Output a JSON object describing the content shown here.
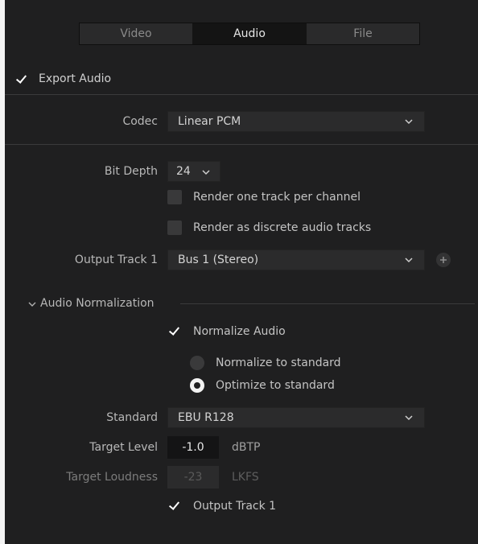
{
  "tabs": [
    {
      "label": "Video",
      "active": false
    },
    {
      "label": "Audio",
      "active": true
    },
    {
      "label": "File",
      "active": false
    }
  ],
  "export_audio": {
    "label": "Export Audio",
    "checked": true
  },
  "codec": {
    "label": "Codec",
    "value": "Linear PCM"
  },
  "bit_depth": {
    "label": "Bit Depth",
    "value": "24"
  },
  "render_one_track": {
    "label": "Render one track per channel",
    "checked": false
  },
  "render_discrete": {
    "label": "Render as discrete audio tracks",
    "checked": false
  },
  "output_track": {
    "label": "Output Track 1",
    "value": "Bus 1 (Stereo)",
    "add_icon": "plus-icon"
  },
  "normalization": {
    "section_label": "Audio Normalization",
    "normalize_audio": {
      "label": "Normalize Audio",
      "checked": true
    },
    "normalize_to_standard": {
      "label": "Normalize to standard",
      "selected": false
    },
    "optimize_to_standard": {
      "label": "Optimize to standard",
      "selected": true
    },
    "standard": {
      "label": "Standard",
      "value": "EBU R128"
    },
    "target_level": {
      "label": "Target Level",
      "value": "-1.0",
      "unit": "dBTP"
    },
    "target_loudness": {
      "label": "Target Loudness",
      "value": "-23",
      "unit": "LKFS"
    },
    "output_track_check": {
      "label": "Output Track 1",
      "checked": true
    }
  },
  "colors": {
    "panel_bg": "#1f1f20",
    "field_bg": "#2b2b2c",
    "text": "#c4c4c4"
  }
}
